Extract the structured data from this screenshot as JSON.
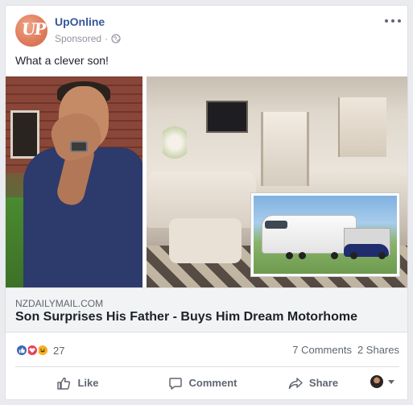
{
  "post": {
    "page_name": "UpOnline",
    "sponsored_label": "Sponsored",
    "meta_separator": "·",
    "text": "What a clever son!",
    "avatar_text": "UP"
  },
  "link": {
    "domain": "NZDAILYMAIL.COM",
    "headline": "Son Surprises His Father - Buys Him Dream Motorhome"
  },
  "engagement": {
    "reaction_count": "27",
    "comments": "7 Comments",
    "shares": "2 Shares",
    "reaction_icons": [
      "like-reaction-icon",
      "love-reaction-icon",
      "haha-reaction-icon"
    ]
  },
  "actions": {
    "like": "Like",
    "comment": "Comment",
    "share": "Share"
  },
  "colors": {
    "page_name": "#365899",
    "like_blue": "#4267b2",
    "love_red": "#e9405a",
    "haha_yellow": "#f7b125",
    "muted_text": "#606770"
  }
}
